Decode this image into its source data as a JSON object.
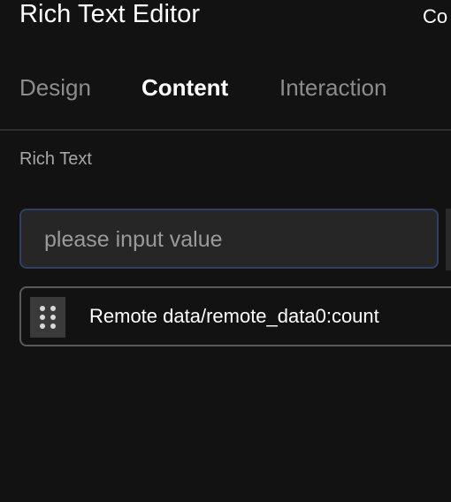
{
  "header": {
    "title": "Rich Text Editor",
    "right_text": "Co"
  },
  "tabs": [
    {
      "label": "Design",
      "active": false
    },
    {
      "label": "Content",
      "active": true
    },
    {
      "label": "Interaction",
      "active": false
    }
  ],
  "section": {
    "label": "Rich Text"
  },
  "input": {
    "value": "",
    "placeholder": "please input value"
  },
  "data_item": {
    "label": "Remote data/remote_data0:count",
    "icon": "drag-handle-icon"
  },
  "colors": {
    "background": "#121212",
    "input_border": "#2f3f66",
    "input_background": "#262626",
    "inactive_tab": "#8c8c8c",
    "active_tab": "#ffffff"
  }
}
